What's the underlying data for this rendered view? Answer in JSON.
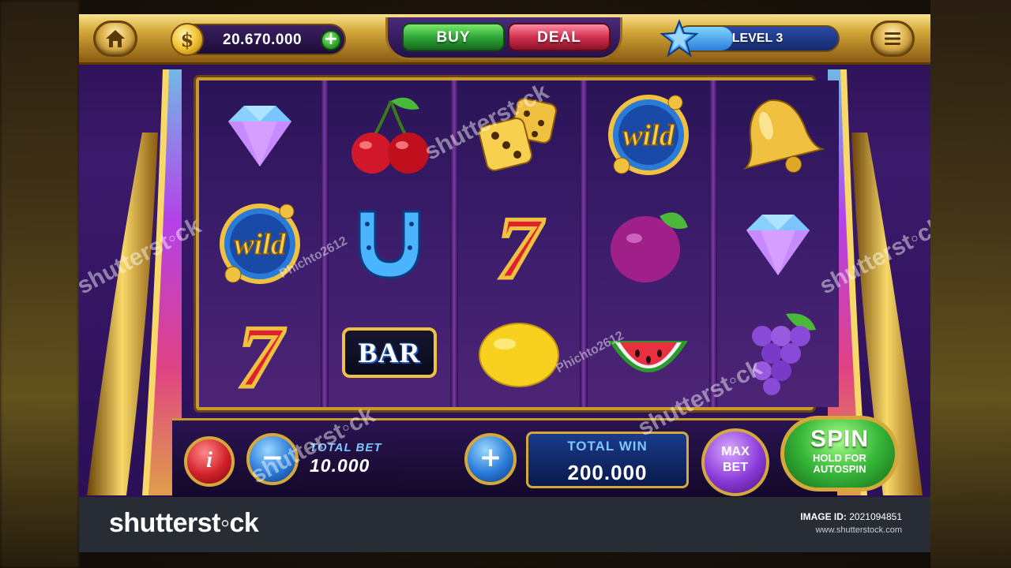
{
  "top_bar": {
    "coin_symbol": "$",
    "coin_balance": "20.670.000",
    "add_coins_label": "+",
    "buy_label": "BUY",
    "deal_label": "DEAL",
    "level_label": "LEVEL 3",
    "level_progress": 0.35
  },
  "reels": [
    [
      "diamond",
      "wild",
      "seven"
    ],
    [
      "cherry",
      "horseshoe",
      "bar"
    ],
    [
      "dice",
      "seven",
      "lemon"
    ],
    [
      "wild",
      "plum",
      "watermelon"
    ],
    [
      "bell",
      "diamond",
      "grapes"
    ]
  ],
  "symbols": {
    "wild_text": "wild",
    "bar_text": "BAR",
    "seven_text": "7"
  },
  "controls": {
    "info_label": "i",
    "minus_label": "−",
    "plus_label": "+",
    "total_bet_label": "TOTAL BET",
    "total_bet_value": "10.000",
    "total_win_label": "TOTAL WIN",
    "total_win_value": "200.000",
    "max_bet_label_1": "MAX",
    "max_bet_label_2": "BET",
    "spin_label": "SPIN",
    "spin_sub_1": "HOLD FOR",
    "spin_sub_2": "AUTOSPIN"
  },
  "watermark": {
    "logo": "shutterst◦ck",
    "overlay_text": "shutterst◦ck",
    "author_text": "Phichto2612",
    "image_id_label": "IMAGE ID:",
    "image_id": "2021094851",
    "url": "www.shutterstock.com"
  },
  "colors": {
    "gold": "#d4a83a",
    "buy_green": "#2fa838",
    "deal_red": "#d0304e",
    "spin_green": "#38b83a",
    "level_blue": "#2a7fd8"
  },
  "icons": [
    "home-icon",
    "menu-icon",
    "coin-icon",
    "star-icon"
  ]
}
